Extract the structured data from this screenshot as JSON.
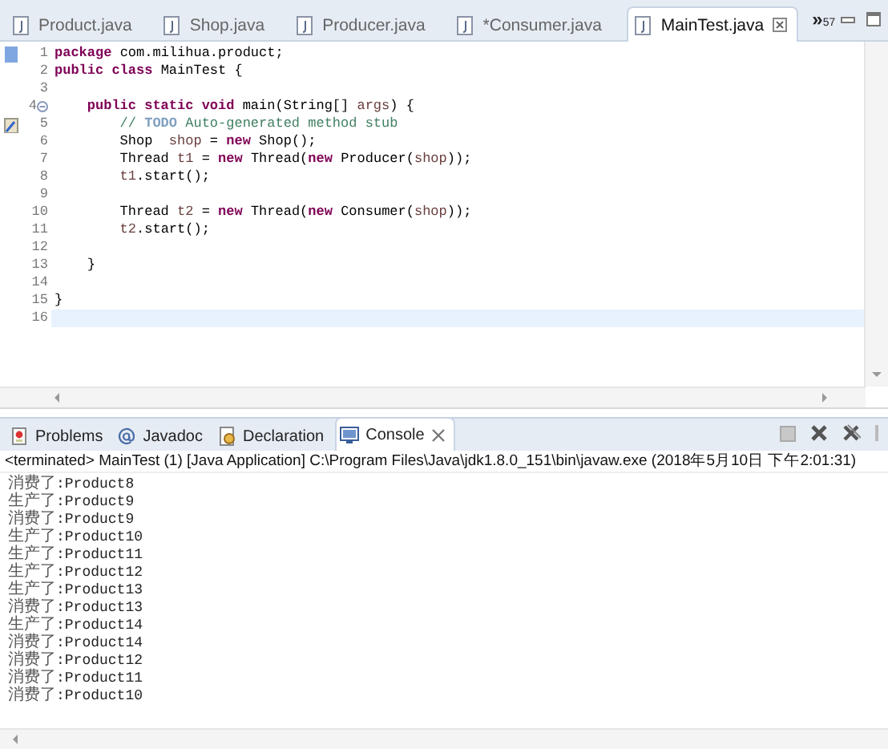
{
  "editor_tabs": [
    {
      "label": "Product.java",
      "selected": false
    },
    {
      "label": "Shop.java",
      "selected": false
    },
    {
      "label": "Producer.java",
      "selected": false
    },
    {
      "label": "*Consumer.java",
      "selected": false
    },
    {
      "label": "MainTest.java",
      "selected": true
    }
  ],
  "tab_overflow": {
    "symbol": "»",
    "count": "57"
  },
  "code_lines": [
    {
      "number": "1",
      "bookmark": true,
      "segments": [
        {
          "kind": "keyword",
          "text": "package"
        },
        {
          "kind": "plain",
          "text": " com.milihua.product;"
        }
      ]
    },
    {
      "number": "2",
      "segments": [
        {
          "kind": "keyword",
          "text": "public class"
        },
        {
          "kind": "plain",
          "text": " MainTest {"
        }
      ]
    },
    {
      "number": "3"
    },
    {
      "number": "4",
      "fold": true,
      "segments": [
        {
          "kind": "keyword",
          "text": "    public static void"
        },
        {
          "kind": "plain",
          "text": " main(String[] "
        },
        {
          "kind": "param",
          "text": "args"
        },
        {
          "kind": "plain",
          "text": ") {"
        }
      ]
    },
    {
      "number": "5",
      "task": true,
      "segments": [
        {
          "kind": "comment",
          "text": "        // "
        },
        {
          "kind": "todo",
          "text": "TODO"
        },
        {
          "kind": "comment",
          "text": " Auto-generated method stub"
        }
      ]
    },
    {
      "number": "6",
      "segments": [
        {
          "kind": "plain",
          "text": "        Shop  "
        },
        {
          "kind": "local",
          "text": "shop"
        },
        {
          "kind": "plain",
          "text": " = "
        },
        {
          "kind": "keyword",
          "text": "new"
        },
        {
          "kind": "plain",
          "text": " Shop();"
        }
      ]
    },
    {
      "number": "7",
      "segments": [
        {
          "kind": "plain",
          "text": "        Thread "
        },
        {
          "kind": "local",
          "text": "t1"
        },
        {
          "kind": "plain",
          "text": " = "
        },
        {
          "kind": "keyword",
          "text": "new"
        },
        {
          "kind": "plain",
          "text": " Thread("
        },
        {
          "kind": "keyword",
          "text": "new"
        },
        {
          "kind": "plain",
          "text": " Producer("
        },
        {
          "kind": "local",
          "text": "shop"
        },
        {
          "kind": "plain",
          "text": "));"
        }
      ]
    },
    {
      "number": "8",
      "segments": [
        {
          "kind": "local",
          "text": "        t1"
        },
        {
          "kind": "plain",
          "text": ".start();"
        }
      ]
    },
    {
      "number": "9"
    },
    {
      "number": "10",
      "segments": [
        {
          "kind": "plain",
          "text": "        Thread "
        },
        {
          "kind": "local",
          "text": "t2"
        },
        {
          "kind": "plain",
          "text": " = "
        },
        {
          "kind": "keyword",
          "text": "new"
        },
        {
          "kind": "plain",
          "text": " Thread("
        },
        {
          "kind": "keyword",
          "text": "new"
        },
        {
          "kind": "plain",
          "text": " Consumer("
        },
        {
          "kind": "local",
          "text": "shop"
        },
        {
          "kind": "plain",
          "text": "));"
        }
      ]
    },
    {
      "number": "11",
      "segments": [
        {
          "kind": "local",
          "text": "        t2"
        },
        {
          "kind": "plain",
          "text": ".start();"
        }
      ]
    },
    {
      "number": "12"
    },
    {
      "number": "13",
      "segments": [
        {
          "kind": "plain",
          "text": "    }"
        }
      ]
    },
    {
      "number": "14"
    },
    {
      "number": "15",
      "segments": [
        {
          "kind": "plain",
          "text": "}"
        }
      ]
    },
    {
      "number": "16",
      "current": true
    }
  ],
  "panel_tabs": [
    {
      "label": "Problems",
      "kind": "problems",
      "selected": false
    },
    {
      "label": "Javadoc",
      "kind": "javadoc",
      "selected": false
    },
    {
      "label": "Declaration",
      "kind": "declaration",
      "selected": false
    },
    {
      "label": "Console",
      "kind": "console",
      "selected": true
    }
  ],
  "console": {
    "header": "<terminated> MainTest (1) [Java Application] C:\\Program Files\\Java\\jdk1.8.0_151\\bin\\javaw.exe (2018年5月10日 下午2:01:31)",
    "lines": [
      {
        "action": "消费了",
        "item": ":Product8"
      },
      {
        "action": "生产了",
        "item": ":Product9"
      },
      {
        "action": "消费了",
        "item": ":Product9"
      },
      {
        "action": "生产了",
        "item": ":Product10"
      },
      {
        "action": "生产了",
        "item": ":Product11"
      },
      {
        "action": "生产了",
        "item": ":Product12"
      },
      {
        "action": "生产了",
        "item": ":Product13"
      },
      {
        "action": "消费了",
        "item": ":Product13"
      },
      {
        "action": "生产了",
        "item": ":Product14"
      },
      {
        "action": "消费了",
        "item": ":Product14"
      },
      {
        "action": "消费了",
        "item": ":Product12"
      },
      {
        "action": "消费了",
        "item": ":Product11"
      },
      {
        "action": "消费了",
        "item": ":Product10"
      }
    ]
  }
}
